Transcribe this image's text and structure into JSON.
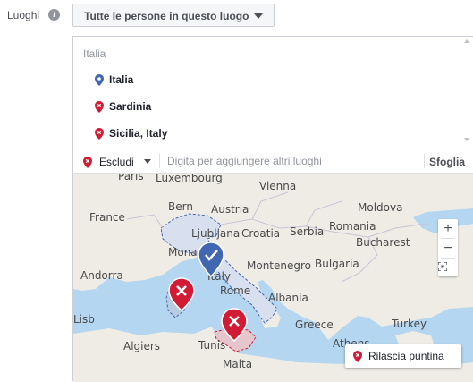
{
  "locations_field": {
    "label": "Luoghi",
    "info_icon": "info-icon",
    "audience_dropdown": "Tutte le persone in questo luogo"
  },
  "results": {
    "header": "Italia",
    "items": [
      {
        "label": "Italia",
        "pin": "include-pin-icon",
        "color": "#4267b2"
      },
      {
        "label": "Sardinia",
        "pin": "exclude-pin-icon",
        "color": "#d21c35"
      },
      {
        "label": "Sicilia, Italy",
        "pin": "exclude-pin-icon",
        "color": "#d21c35"
      }
    ]
  },
  "search": {
    "mode": "Escludi",
    "placeholder": "Digita per aggiungere altri luoghi",
    "browse": "Sfoglia"
  },
  "map": {
    "labels": {
      "paris": "Paris",
      "luxembourg": "Luxembourg",
      "france": "France",
      "bern": "Bern",
      "austria": "Austria",
      "vienna": "Vienna",
      "ljubljana": "Ljubljana",
      "croatia": "Croatia",
      "monaco": "Monaco",
      "serbia": "Serbia",
      "romania": "Romania",
      "moldova": "Moldova",
      "bucharest": "Bucharest",
      "andorra": "Andorra",
      "montenegro": "Montenegro",
      "bulgaria": "Bulgaria",
      "italy": "Italy",
      "rome": "Rome",
      "albania": "Albania",
      "greece": "Greece",
      "turkey": "Turkey",
      "algiers": "Algiers",
      "tunis": "Tunis",
      "athens": "Athens",
      "malta": "Malta",
      "lisb": "Lisb"
    },
    "zoom_in": "+",
    "zoom_out": "−",
    "fullscreen_icon": "fullscreen-icon",
    "drop_pin_label": "Rilascia puntina",
    "include_color": "#4267b2",
    "exclude_color": "#d21c35"
  }
}
